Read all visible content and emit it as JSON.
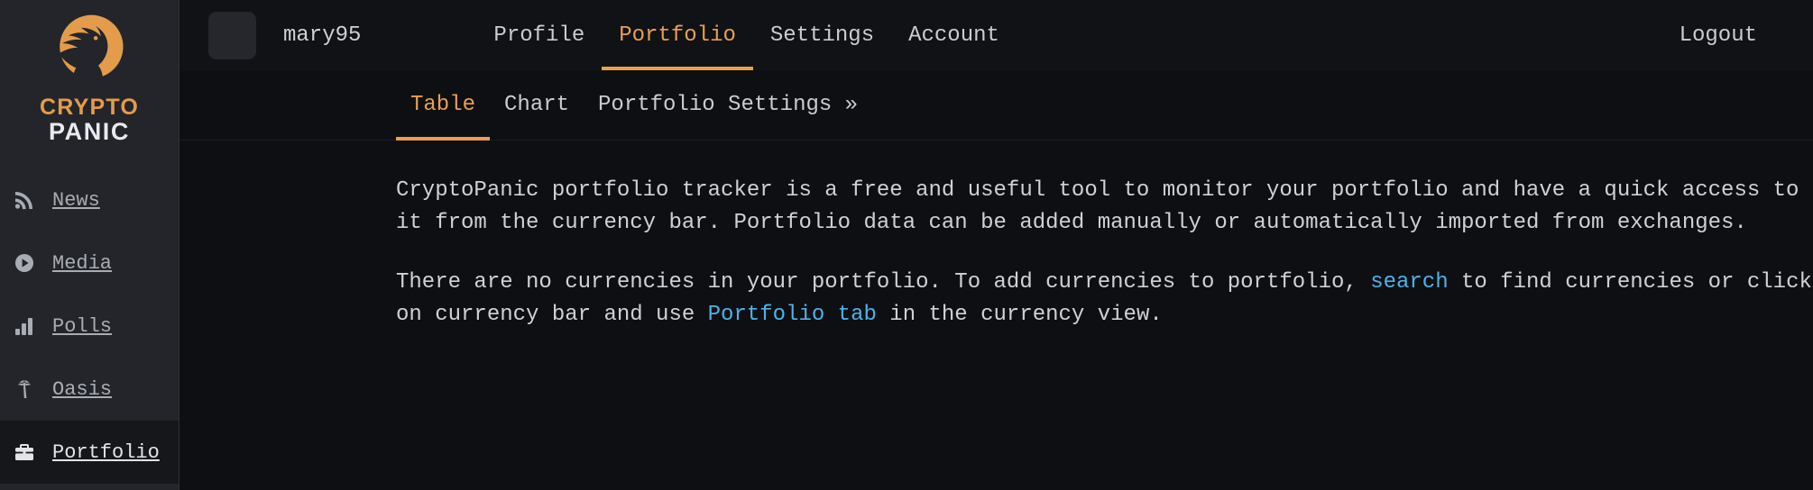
{
  "sidebar": {
    "logo": {
      "icon": "wolf-howling-icon",
      "line1": "CRYPTO",
      "line2": "PANIC"
    },
    "items": [
      {
        "label": "News",
        "icon": "rss-icon",
        "active": false
      },
      {
        "label": "Media",
        "icon": "play-circle-icon",
        "active": false
      },
      {
        "label": "Polls",
        "icon": "bar-chart-icon",
        "active": false
      },
      {
        "label": "Oasis",
        "icon": "palm-tree-icon",
        "active": false
      },
      {
        "label": "Portfolio",
        "icon": "briefcase-icon",
        "active": true
      }
    ]
  },
  "header": {
    "avatar_icon": "user-avatar-placeholder",
    "username": "mary95",
    "nav": [
      {
        "label": "Profile",
        "active": false
      },
      {
        "label": "Portfolio",
        "active": true
      },
      {
        "label": "Settings",
        "active": false
      },
      {
        "label": "Account",
        "active": false
      }
    ],
    "logout_label": "Logout"
  },
  "tabs": [
    {
      "label": "Table",
      "active": true
    },
    {
      "label": "Chart",
      "active": false
    },
    {
      "label": "Portfolio Settings »",
      "active": false
    }
  ],
  "main": {
    "paragraph1": "CryptoPanic portfolio tracker is a free and useful tool to monitor your portfolio and have a quick access to it from the currency bar. Portfolio data can be added manually or automatically imported from exchanges.",
    "paragraph2": {
      "part1": "There are no currencies in your portfolio. To add currencies to portfolio, ",
      "link1": "search",
      "part2": " to find currencies or click on currency bar and use ",
      "link2": "Portfolio tab",
      "part3": " in the currency view."
    }
  },
  "colors": {
    "accent_orange": "#e8a04e",
    "link_blue": "#4cb2e8",
    "sidebar_bg": "#23252b",
    "header_bg": "#111216",
    "body_bg": "#0e0f12",
    "text": "#cfd1d5"
  }
}
